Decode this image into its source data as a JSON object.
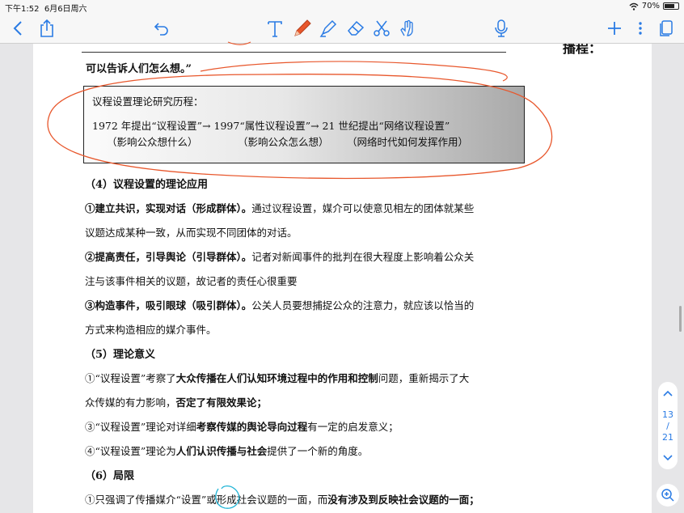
{
  "status": {
    "time": "下午1:52",
    "date": "6月6日周六",
    "battery": "70%"
  },
  "toolbar": {
    "icons": [
      "back-chevron-icon",
      "share-icon",
      "undo-icon",
      "text-tool-icon",
      "pen-icon",
      "highlighter-icon",
      "eraser-icon",
      "scissors-icon",
      "hand-icon",
      "microphone-icon",
      "add-icon",
      "more-icon",
      "pages-icon"
    ],
    "accent": "#2a7be4",
    "pen_color": "#e8572c"
  },
  "doc": {
    "heading_tail": "播程：",
    "quote_line": "可以告诉人们怎么想。”",
    "box": {
      "title": "议程设置理论研究历程：",
      "timeline": "1972 年提出“议程设置”→ 1997“属性议程设置”→ 21 世纪提出“网络议程设置”",
      "notes": [
        "（影响公众想什么）",
        "（影响公众怎么想）",
        "（网络时代如何发挥作用）"
      ]
    },
    "s4_heading": "（4）议程设置的理论应用",
    "s4_1_bold": "①建立共识，实现对话（形成群体）。",
    "s4_1_rest": "通过议程设置，媒介可以使意见相左的团体就某些",
    "s4_1_line2": "议题达成某种一致，从而实现不同团体的对话。",
    "s4_2_bold": "②提高责任，引导舆论（引导群体）。",
    "s4_2_rest": "记者对新闻事件的批判在很大程度上影响着公众关",
    "s4_2_line2": "注与该事件相关的议题，故记者的责任心很重要",
    "s4_3_bold": "③构造事件，吸引眼球（吸引群体）。",
    "s4_3_rest": "公关人员要想捕捉公众的注意力，就应该以恰当的",
    "s4_3_line2": "方式来构造相应的媒介事件。",
    "s5_heading": "（5）理论意义",
    "s5_1_a": "①“议程设置”考察了",
    "s5_1_b": "大众传播在人们认知环境过程中的作用和控制",
    "s5_1_c": "问题，重新揭示了大",
    "s5_1_line2_a": "众传媒的有力影响，",
    "s5_1_line2_b": "否定了有限效果论；",
    "s5_2_a": "③“议程设置”理论对详细",
    "s5_2_b": "考察传媒的舆论导向过程",
    "s5_2_c": "有一定的启发意义；",
    "s5_3_a": "④“议程设置”理论为",
    "s5_3_b": "人们认识传播与社会",
    "s5_3_c": "提供了一个新的角度。",
    "s6_heading": "（6）局限",
    "s6_1_a": "①只强调了传播媒介“设置”或形成社会议题的一面，而",
    "s6_1_b": "没有涉及到反映社会议题的一面；"
  },
  "pager": {
    "current": "13",
    "separator": "/",
    "total": "21"
  }
}
